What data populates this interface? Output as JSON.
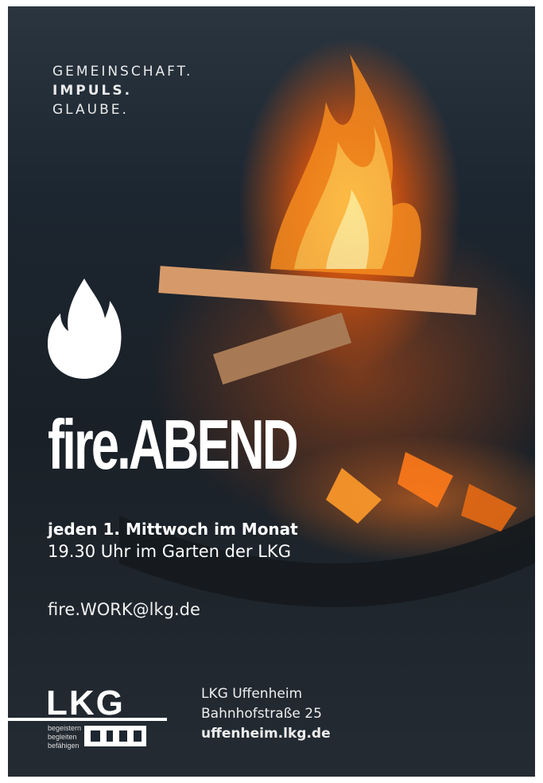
{
  "tagline": {
    "line1": "GEMEINSCHAFT.",
    "line2": "IMPULS.",
    "line3": "GLAUBE."
  },
  "title": "fire.ABEND",
  "event": {
    "schedule": "jeden 1. Mittwoch im Monat",
    "time_place": "19.30 Uhr im Garten der LKG"
  },
  "contact": {
    "email": "fire.WORK@lkg.de"
  },
  "logo": {
    "wordmark": "LKG",
    "slogan": [
      "begeistern",
      "begleiten",
      "befähigen"
    ]
  },
  "address": {
    "name": "LKG Uffenheim",
    "street": "Bahnhofstraße 25",
    "website": "uffenheim.lkg.de"
  },
  "colors": {
    "background": "#1c2630",
    "text": "#ffffff",
    "fire": "#f07a1a"
  },
  "icons": [
    "flame-icon"
  ]
}
